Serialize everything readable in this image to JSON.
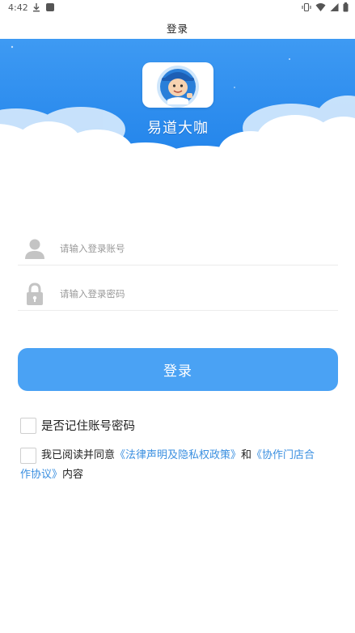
{
  "status_bar": {
    "time": "4:42",
    "icons_left": [
      "download-icon",
      "app-notification-icon"
    ],
    "icons_right": [
      "vibrate-icon",
      "wifi-icon",
      "signal-icon",
      "battery-icon"
    ]
  },
  "header": {
    "title": "登录"
  },
  "banner": {
    "app_name": "易道大咖",
    "sky_color": "#2d8ef0",
    "cloud_color": "#ffffff"
  },
  "form": {
    "account": {
      "placeholder": "请输入登录账号",
      "value": "",
      "icon": "user-icon"
    },
    "password": {
      "placeholder": "请输入登录密码",
      "value": "",
      "icon": "lock-icon"
    },
    "login_button": "登录",
    "accent_color": "#4aa2f4"
  },
  "options": {
    "remember_label": "是否记住账号密码",
    "remember_checked": false,
    "agree_checked": false,
    "agree_prefix": "我已阅读并同意",
    "legal_link": "《法律声明及隐私权政策》",
    "agree_and": "和",
    "coop_link_part1": "《协作门店合",
    "coop_link_part2": "作协议》",
    "agree_suffix": "内容",
    "link_color": "#3a8fe0"
  }
}
